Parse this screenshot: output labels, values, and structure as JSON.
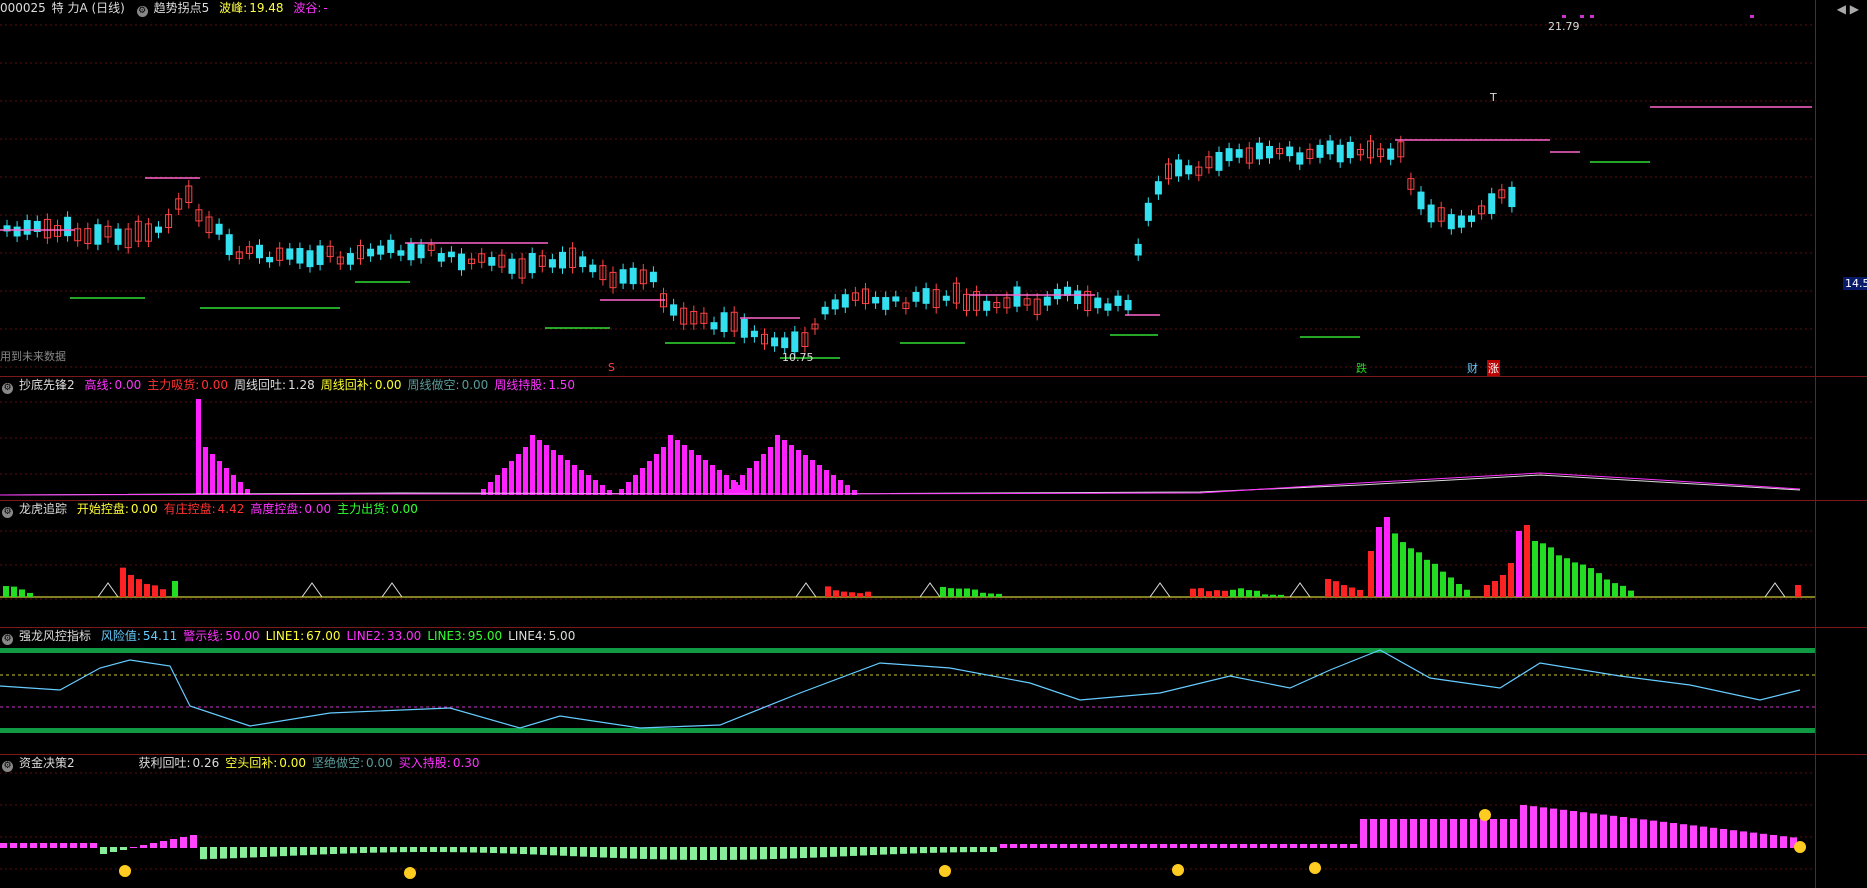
{
  "main": {
    "title_code": "000025",
    "title_name": "特 力A (日线)",
    "indicator": "趋势拐点5",
    "peak_label": "波峰:",
    "peak_value": "19.48",
    "trough_label": "波谷:",
    "trough_value": "-",
    "high_label": "21.79",
    "low_label": "10.75",
    "future_note": "用到未来数据",
    "current_price": "14.5",
    "markers": {
      "s": "S",
      "die": "跌",
      "cai": "财",
      "zhang": "涨",
      "t": "T"
    }
  },
  "pane1": {
    "name": "抄底先锋2",
    "items": [
      {
        "label": "高线:",
        "value": "0.00",
        "color": "#ff33ff"
      },
      {
        "label": "主力吸货:",
        "value": "0.00",
        "color": "#ff3333"
      },
      {
        "label": "周线回吐:",
        "value": "1.28",
        "color": "#dddddd"
      },
      {
        "label": "周线回补:",
        "value": "0.00",
        "color": "#ffff33"
      },
      {
        "label": "周线做空:",
        "value": "0.00",
        "color": "#5a9a9a"
      },
      {
        "label": "周线持股:",
        "value": "1.50",
        "color": "#ff33ff"
      }
    ]
  },
  "pane2": {
    "name": "龙虎追踪",
    "items": [
      {
        "label": "开始控盘:",
        "value": "0.00",
        "color": "#ffff33"
      },
      {
        "label": "有庄控盘:",
        "value": "4.42",
        "color": "#ff3333"
      },
      {
        "label": "高度控盘:",
        "value": "0.00",
        "color": "#ff33ff"
      },
      {
        "label": "主力出货:",
        "value": "0.00",
        "color": "#33ff33"
      }
    ]
  },
  "pane3": {
    "name": "强龙风控指标",
    "items": [
      {
        "label": "风险值:",
        "value": "54.11",
        "color": "#66ccff"
      },
      {
        "label": "警示线:",
        "value": "50.00",
        "color": "#ff33ff"
      },
      {
        "label": "LINE1:",
        "value": "67.00",
        "color": "#ffff33"
      },
      {
        "label": "LINE2:",
        "value": "33.00",
        "color": "#ff33ff"
      },
      {
        "label": "LINE3:",
        "value": "95.00",
        "color": "#33ff33"
      },
      {
        "label": "LINE4:",
        "value": "5.00",
        "color": "#dddddd"
      }
    ]
  },
  "pane4": {
    "name": "资金决策2",
    "items": [
      {
        "label": "获利回吐:",
        "value": "0.26",
        "color": "#dddddd"
      },
      {
        "label": "空头回补:",
        "value": "0.00",
        "color": "#ffff33"
      },
      {
        "label": "坚绝做空:",
        "value": "0.00",
        "color": "#5a9a9a"
      },
      {
        "label": "买入持股:",
        "value": "0.30",
        "color": "#ff33ff"
      }
    ]
  },
  "colors": {
    "up": "#ff4444",
    "down": "#33e0f0",
    "magenta": "#ff33ff",
    "green": "#22dd22",
    "yellow": "#ffff44"
  }
}
